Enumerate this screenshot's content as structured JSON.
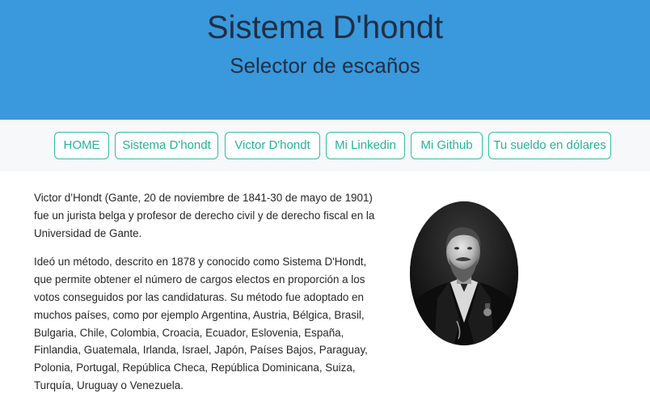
{
  "header": {
    "title": "Sistema D'hondt",
    "subtitle": "Selector de escaños"
  },
  "nav": {
    "items": [
      {
        "label": "HOME"
      },
      {
        "label": "Sistema D'hondt"
      },
      {
        "label": "Victor D'hondt"
      },
      {
        "label": "Mi Linkedin"
      },
      {
        "label": "Mi Github"
      },
      {
        "label": "Tu sueldo en dólares"
      }
    ]
  },
  "bio": {
    "paragraph1": "Victor d’Hondt (Gante, 20 de noviembre de 1841-30 de mayo de 1901) fue un jurista belga y profesor de derecho civil y de derecho fiscal en la Universidad de Gante.",
    "paragraph2": "Ideó un método, descrito en 1878 y conocido como Sistema D'Hondt, que permite obtener el número de cargos electos en proporción a los votos conseguidos por las candidaturas. Su método fue adoptado en muchos países, como por ejemplo Argentina, Austria, Bélgica, Brasil, Bulgaria, Chile, Colombia, Croacia, Ecuador, Eslovenia, España, Finlandia, Guatemala, Irlanda, Israel, Japón, Países Bajos, Paraguay, Polonia, Portugal, República Checa, República Dominicana, Suiza, Turquía, Uruguay o Venezuela."
  },
  "colors": {
    "header_bg": "#3a98dc",
    "nav_bg": "#f7f8fa",
    "accent": "#2ebf9c",
    "text": "#262626"
  }
}
